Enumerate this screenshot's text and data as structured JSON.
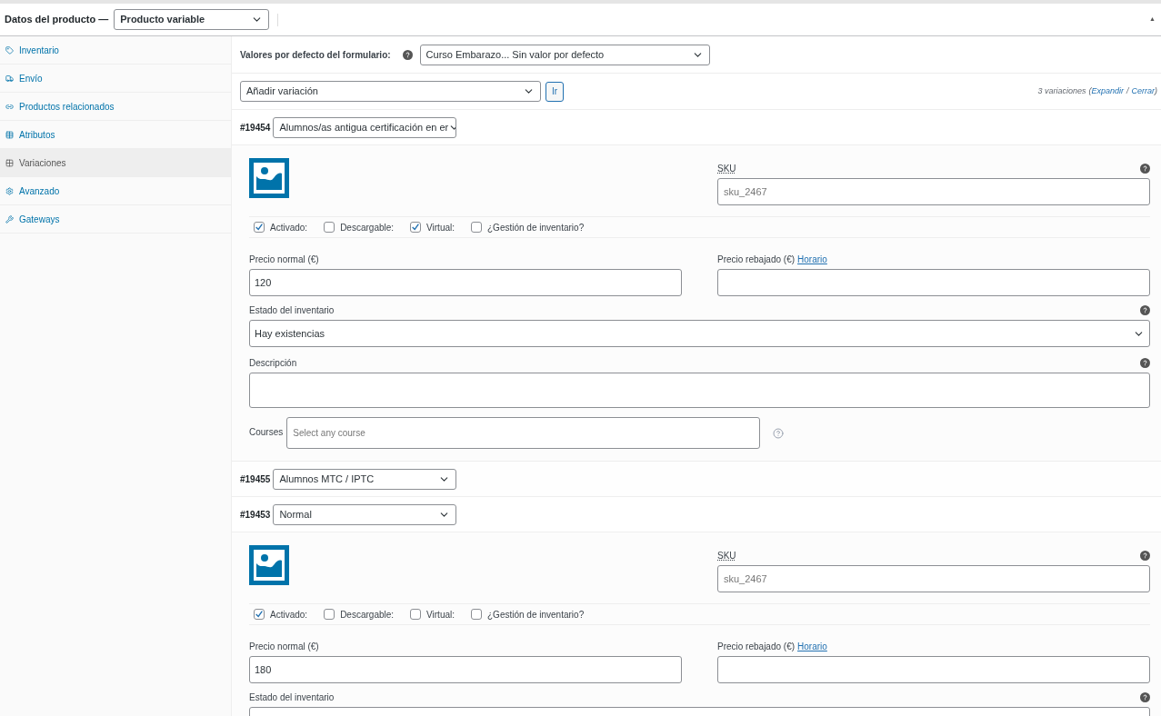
{
  "header": {
    "title": "Datos del producto —",
    "product_type": "Producto variable",
    "collapse_icon": "▲"
  },
  "sidebar": {
    "items": [
      {
        "label": "Inventario",
        "selected": false
      },
      {
        "label": "Envío",
        "selected": false
      },
      {
        "label": "Productos relacionados",
        "selected": false
      },
      {
        "label": "Atributos",
        "selected": false
      },
      {
        "label": "Variaciones",
        "selected": true
      },
      {
        "label": "Avanzado",
        "selected": false
      },
      {
        "label": "Gateways",
        "selected": false
      }
    ]
  },
  "defaults": {
    "label": "Valores por defecto del formulario:",
    "value": "Curso Embarazo... Sin valor por defecto"
  },
  "add_variation": {
    "value": "Añadir variación",
    "button": "Ir"
  },
  "summary": {
    "count": "3 variaciones",
    "open": "(",
    "expand": "Expandir",
    "separator": "/",
    "collapse": "Cerrar",
    "close": ")"
  },
  "variations": [
    {
      "id": "#19454",
      "attribute": "Alumnos/as antigua certificación en er",
      "expanded": true,
      "sku_label": "SKU",
      "sku_placeholder": "sku_2467",
      "checks": [
        {
          "label": "Activado:",
          "checked": true
        },
        {
          "label": "Descargable:",
          "checked": false
        },
        {
          "label": "Virtual:",
          "checked": true
        },
        {
          "label": "¿Gestión de inventario?",
          "checked": false
        }
      ],
      "price_label": "Precio normal (€)",
      "price": "120",
      "sale_label": "Precio rebajado (€)",
      "schedule_link": "Horario",
      "stock_label": "Estado del inventario",
      "stock_value": "Hay existencias",
      "description_label": "Descripción",
      "courses_label": "Courses",
      "courses_placeholder": "Select any course"
    },
    {
      "id": "#19455",
      "attribute": "Alumnos MTC / IPTC",
      "expanded": false
    },
    {
      "id": "#19453",
      "attribute": "Normal",
      "expanded": true,
      "sku_label": "SKU",
      "sku_placeholder": "sku_2467",
      "checks": [
        {
          "label": "Activado:",
          "checked": true
        },
        {
          "label": "Descargable:",
          "checked": false
        },
        {
          "label": "Virtual:",
          "checked": false
        },
        {
          "label": "¿Gestión de inventario?",
          "checked": false
        }
      ],
      "price_label": "Precio normal (€)",
      "price": "180",
      "sale_label": "Precio rebajado (€)",
      "schedule_link": "Horario",
      "stock_label": "Estado del inventario"
    }
  ]
}
